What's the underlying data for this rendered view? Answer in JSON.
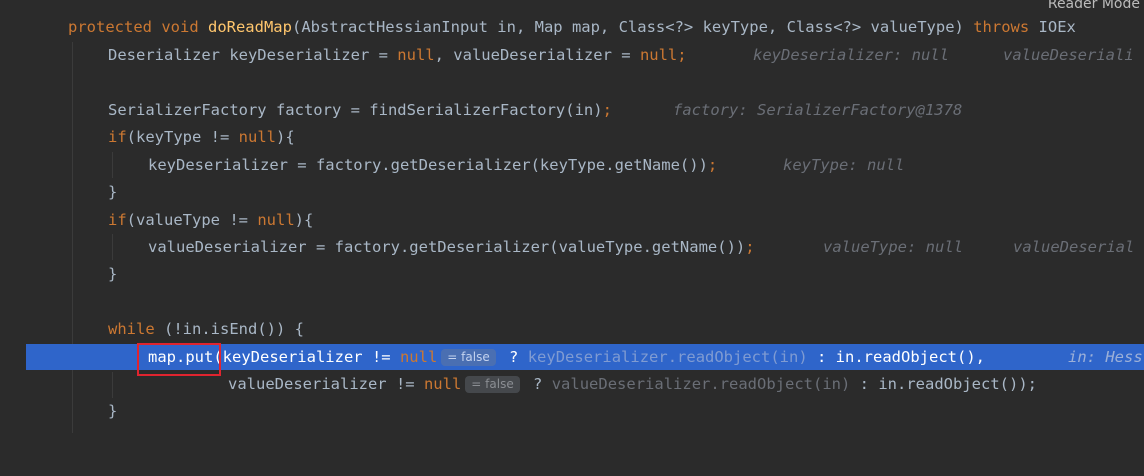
{
  "reader_mode": "Reader Mode",
  "lines": {
    "l1": {
      "kw": "protected void ",
      "fn": "doReadMap",
      "rest": "(AbstractHessianInput in, Map map, Class<?> keyType, Class<?> valueType) ",
      "throws": "throws",
      "tail": " IOEx"
    },
    "l2": {
      "a": "Deserializer keyDeserializer = ",
      "null1": "null",
      "b": ", valueDeserializer = ",
      "null2": "null",
      "semi": ";",
      "hint1": "keyDeserializer: null",
      "hint2": "valueDeseriali"
    },
    "l4": {
      "code": "SerializerFactory factory = findSerializerFactory(in)",
      "semi": ";",
      "hint": "factory: SerializerFactory@1378"
    },
    "l5": {
      "kw": "if",
      "a": "(keyType != ",
      "null": "null",
      "b": "){"
    },
    "l6": {
      "code": "keyDeserializer = factory.getDeserializer(keyType.getName())",
      "semi": ";",
      "hint": "keyType: null"
    },
    "l7": {
      "code": "}"
    },
    "l8": {
      "kw": "if",
      "a": "(valueType != ",
      "null": "null",
      "b": "){"
    },
    "l9": {
      "code": "valueDeserializer = factory.getDeserializer(valueType.getName())",
      "semi": ";",
      "hint1": "valueType: null",
      "hint2": "valueDeserial"
    },
    "l10": {
      "code": "}"
    },
    "l12": {
      "kw": "while",
      "code": " (!in.isEnd()) {"
    },
    "l13": {
      "a": "map.put(keyDeserializer != ",
      "null": "null",
      "badge": "= false",
      "q": " ? ",
      "dim": "keyDeserializer.readObject(in)",
      "b": " : in.readObject(),",
      "hint": "in: Hess"
    },
    "l14": {
      "a": "valueDeserializer != ",
      "null": "null",
      "badge": "= false",
      "q": " ? ",
      "dim": "valueDeserializer.readObject(in)",
      "b": " : in.readObject());"
    },
    "l15": {
      "code": "}"
    }
  }
}
